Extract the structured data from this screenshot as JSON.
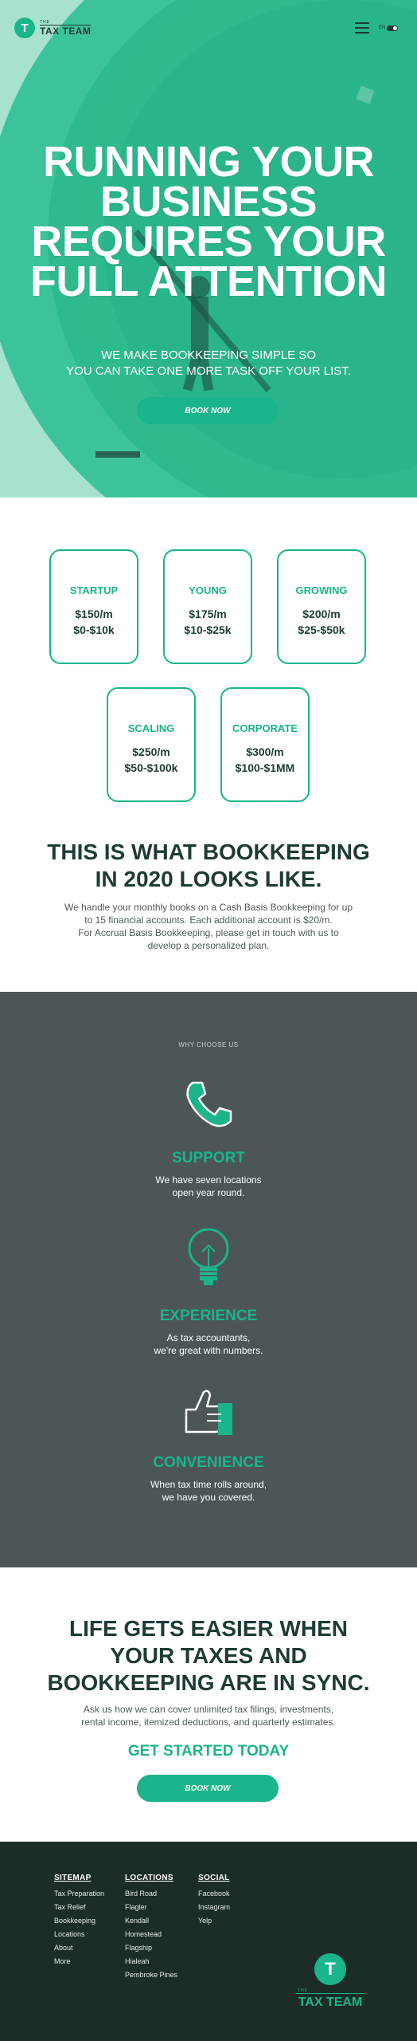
{
  "header": {
    "logo_the": "THE",
    "logo_name": "TAX TEAM",
    "logo_mark": "T",
    "lang_left": "EN",
    "menu_icon": "hamburger-icon"
  },
  "hero": {
    "title": "RUNNING YOUR BUSINESS REQUIRES YOUR FULL ATTENTION",
    "subtitle_line1": "WE MAKE BOOKKEEPING SIMPLE SO",
    "subtitle_line2": "YOU CAN TAKE ONE MORE TASK OFF YOUR LIST.",
    "button": "BOOK NOW"
  },
  "plans": [
    {
      "name": "STARTUP",
      "price": "$150/m",
      "range": "$0-$10k"
    },
    {
      "name": "YOUNG",
      "price": "$175/m",
      "range": "$10-$25k"
    },
    {
      "name": "GROWING",
      "price": "$200/m",
      "range": "$25-$50k"
    },
    {
      "name": "SCALING",
      "price": "$250/m",
      "range": "$50-$100k"
    },
    {
      "name": "CORPORATE",
      "price": "$300/m",
      "range": "$100-$1MM"
    }
  ],
  "bookkeeping": {
    "title_line1": "THIS IS WHAT BOOKKEEPING",
    "title_line2": "IN 2020 LOOKS LIKE.",
    "text_line1": "We handle your monthly books on a Cash Basis Bookkeeping for up",
    "text_line2": "to 15 financial accounts. Each additional account is $20/m.",
    "text_line3": "For Accrual Basis Bookkeeping, please get in touch with us to",
    "text_line4": "develop a personalized plan."
  },
  "why": {
    "label": "WHY CHOOSE US",
    "features": [
      {
        "icon": "phone-icon",
        "title": "SUPPORT",
        "line1": "We have seven locations",
        "line2": "open year round."
      },
      {
        "icon": "lightbulb-icon",
        "title": "EXPERIENCE",
        "line1": "As tax accountants,",
        "line2": "we're great with numbers."
      },
      {
        "icon": "thumbs-up-icon",
        "title": "CONVENIENCE",
        "line1": "When tax time rolls around,",
        "line2": "we have you covered."
      }
    ]
  },
  "cta": {
    "title_line1": "LIFE GETS EASIER WHEN",
    "title_line2": "YOUR TAXES AND",
    "title_line3": "BOOKKEEPING ARE IN SYNC.",
    "text_line1": "Ask us how we can cover unlimited tax filings, investments,",
    "text_line2": "rental income, itemized deductions, and quarterly estimates.",
    "green": "GET STARTED TODAY",
    "button": "BOOK NOW"
  },
  "footer": {
    "sitemap": {
      "heading": "SITEMAP",
      "links": [
        "Tax Preparation",
        "Tax Relief",
        "Bookkeeping",
        "Locations",
        "About",
        "More"
      ]
    },
    "locations": {
      "heading": "LOCATIONS",
      "links": [
        "Bird Road",
        "Flagler",
        "Kendall",
        "Homestead",
        "Flagship",
        "Hialeah",
        "Pembroke Pines"
      ]
    },
    "social": {
      "heading": "SOCIAL",
      "links": [
        "Facebook",
        "Instagram",
        "Yelp"
      ]
    },
    "logo_the": "THE",
    "logo_name": "TAX TEAM",
    "logo_mark": "T"
  },
  "colors": {
    "accent": "#1ab58a",
    "dark": "#1e3b36",
    "slate": "#4c5659",
    "footer": "#1b2c29",
    "hero_bg": "#a6e2cf"
  }
}
